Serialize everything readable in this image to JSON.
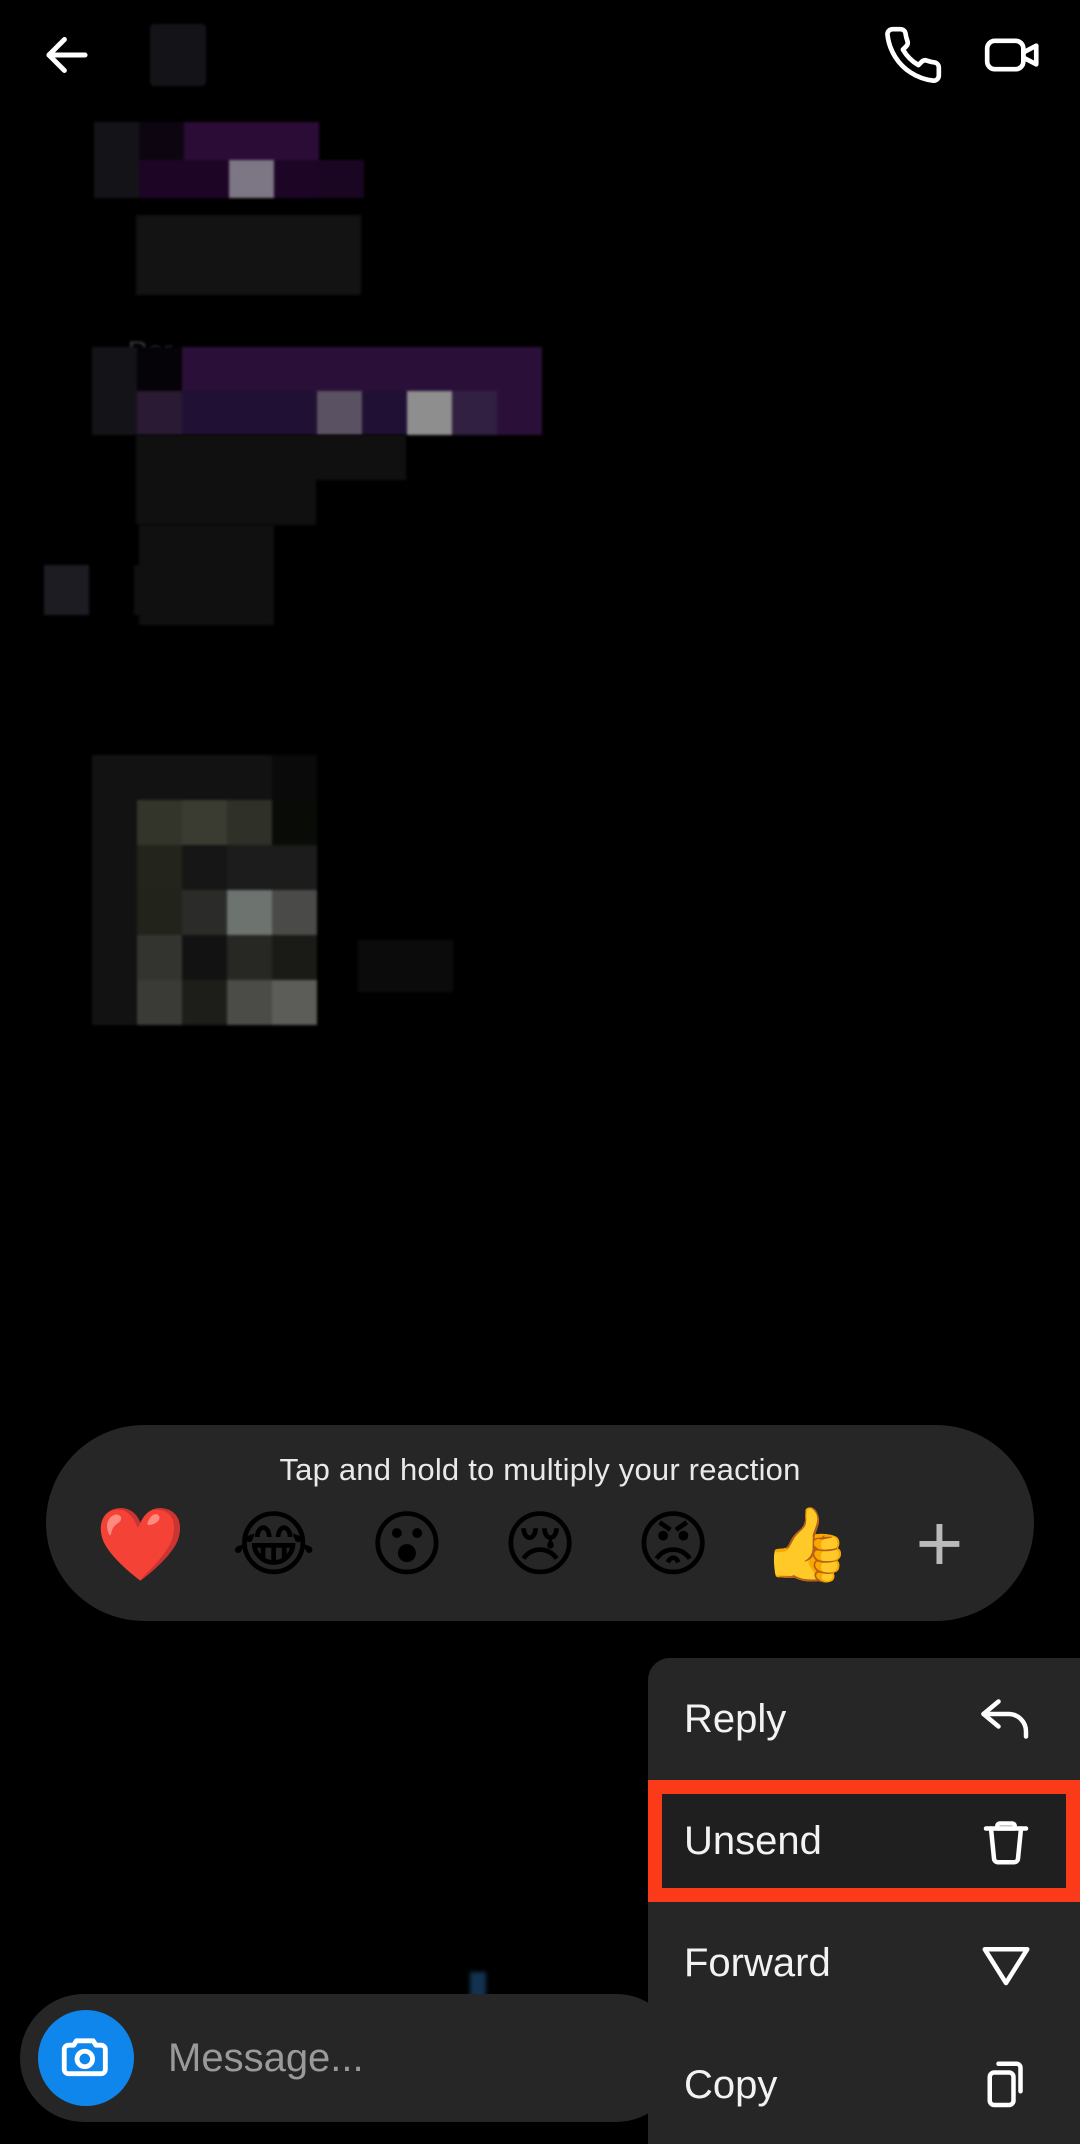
{
  "app": {
    "theme": "dark",
    "background": "#000000"
  },
  "header": {
    "back_icon": "back-arrow-icon",
    "contact_name": "",
    "audio_call_icon": "phone-icon",
    "video_call_icon": "video-camera-icon"
  },
  "conversation": {
    "reply_label": "Rer",
    "messages": [
      {
        "id": "msg-1",
        "sender": "incoming",
        "content": "",
        "censored": true
      },
      {
        "id": "msg-2",
        "sender": "incoming",
        "content": "",
        "censored": true
      },
      {
        "id": "msg-3",
        "sender": "incoming",
        "content": "",
        "censored": true
      },
      {
        "id": "msg-4",
        "sender": "incoming",
        "content": "",
        "censored": true,
        "type": "media"
      },
      {
        "id": "msg-5",
        "sender": "outgoing",
        "content": "",
        "censored": true
      }
    ]
  },
  "reaction_bar": {
    "hint": "Tap and hold to multiply your reaction",
    "background": "#262626",
    "reactions": [
      {
        "name": "heart-reaction",
        "glyph": "❤️"
      },
      {
        "name": "laughing-reaction",
        "glyph": "😂"
      },
      {
        "name": "surprised-reaction",
        "glyph": "😮"
      },
      {
        "name": "sad-reaction",
        "glyph": "😢"
      },
      {
        "name": "angry-reaction",
        "glyph": "😡"
      },
      {
        "name": "thumbs-up-reaction",
        "glyph": "👍"
      }
    ],
    "add_more_label": "+"
  },
  "context_menu": {
    "background": "#262626",
    "highlight_color": "#FA3A19",
    "items": [
      {
        "label": "Reply",
        "icon": "reply-arrow-icon",
        "highlighted": false
      },
      {
        "label": "Unsend",
        "icon": "trash-icon",
        "highlighted": true
      },
      {
        "label": "Forward",
        "icon": "paper-plane-icon",
        "highlighted": false
      },
      {
        "label": "Copy",
        "icon": "copy-icon",
        "highlighted": false
      }
    ]
  },
  "composer": {
    "camera_icon": "camera-icon",
    "camera_button_color": "#0f86ec",
    "placeholder": "Message..."
  }
}
